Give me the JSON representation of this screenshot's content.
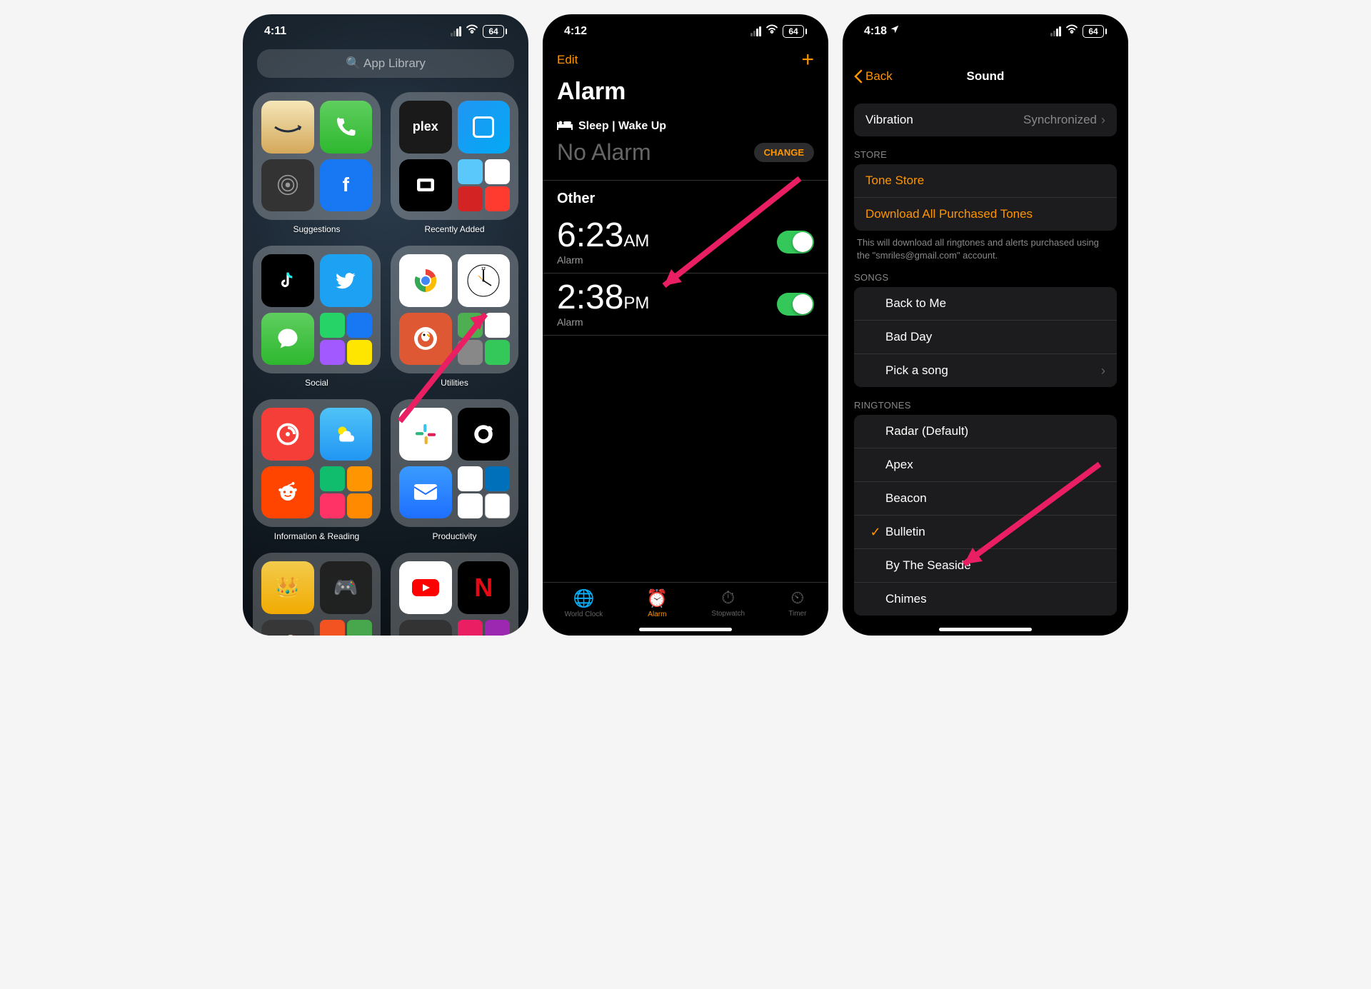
{
  "phone1": {
    "status": {
      "time": "4:11",
      "battery": "64"
    },
    "search": "App Library",
    "folders": [
      {
        "label": "Suggestions"
      },
      {
        "label": "Recently Added"
      },
      {
        "label": "Social"
      },
      {
        "label": "Utilities"
      },
      {
        "label": "Information & Reading"
      },
      {
        "label": "Productivity"
      }
    ]
  },
  "phone2": {
    "status": {
      "time": "4:12",
      "battery": "64"
    },
    "nav": {
      "edit": "Edit"
    },
    "title": "Alarm",
    "sleep_label": "Sleep | Wake Up",
    "no_alarm": "No Alarm",
    "change": "CHANGE",
    "other_header": "Other",
    "alarms": [
      {
        "time": "6:23",
        "period": "AM",
        "label": "Alarm",
        "on": true
      },
      {
        "time": "2:38",
        "period": "PM",
        "label": "Alarm",
        "on": true
      }
    ],
    "tabs": [
      {
        "label": "World Clock"
      },
      {
        "label": "Alarm"
      },
      {
        "label": "Stopwatch"
      },
      {
        "label": "Timer"
      }
    ]
  },
  "phone3": {
    "status": {
      "time": "4:18",
      "battery": "64"
    },
    "nav": {
      "back": "Back",
      "title": "Sound"
    },
    "vibration": {
      "label": "Vibration",
      "value": "Synchronized"
    },
    "store": {
      "header": "STORE",
      "tone_store": "Tone Store",
      "download": "Download All Purchased Tones",
      "footer": "This will download all ringtones and alerts purchased using the \"smriles@gmail.com\" account."
    },
    "songs": {
      "header": "SONGS",
      "items": [
        "Back to Me",
        "Bad Day"
      ],
      "pick": "Pick a song"
    },
    "ringtones": {
      "header": "RINGTONES",
      "items": [
        {
          "name": "Radar (Default)",
          "selected": false
        },
        {
          "name": "Apex",
          "selected": false
        },
        {
          "name": "Beacon",
          "selected": false
        },
        {
          "name": "Bulletin",
          "selected": true
        },
        {
          "name": "By The Seaside",
          "selected": false
        },
        {
          "name": "Chimes",
          "selected": false
        }
      ]
    }
  }
}
